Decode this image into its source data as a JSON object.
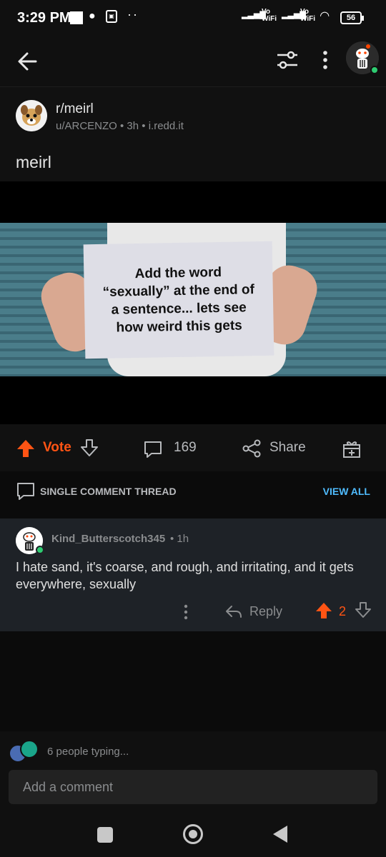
{
  "status_bar": {
    "time": "3:29 PM",
    "dots": "··",
    "signal1": "Vo WiFi",
    "signal2": "Vo WiFi",
    "battery": "56"
  },
  "top_bar": {
    "icons": [
      "back-arrow-icon",
      "filter-icon",
      "more-vertical-icon",
      "profile-avatar"
    ]
  },
  "post": {
    "subreddit": "r/meirl",
    "meta": "u/ARCENZO • 3h • i.redd.it",
    "title": "meirl",
    "image_text": "Add the word\n“sexually” at the end of\na sentence... lets see\nhow weird this gets"
  },
  "actions": {
    "vote_label": "Vote",
    "comment_count": "169",
    "share_label": "Share"
  },
  "thread": {
    "label": "SINGLE COMMENT THREAD",
    "view_all": "VIEW ALL"
  },
  "comment": {
    "username": "Kind_Butterscotch345",
    "time": "• 1h",
    "body": "I hate sand, it's coarse, and rough, and irritating, and it gets everywhere, sexually",
    "reply_label": "Reply",
    "score": "2"
  },
  "composer": {
    "typing": "6 people typing...",
    "placeholder": "Add a comment"
  },
  "colors": {
    "upvote": "#ff5414",
    "link": "#4fbcff",
    "online": "#2ecc71"
  }
}
